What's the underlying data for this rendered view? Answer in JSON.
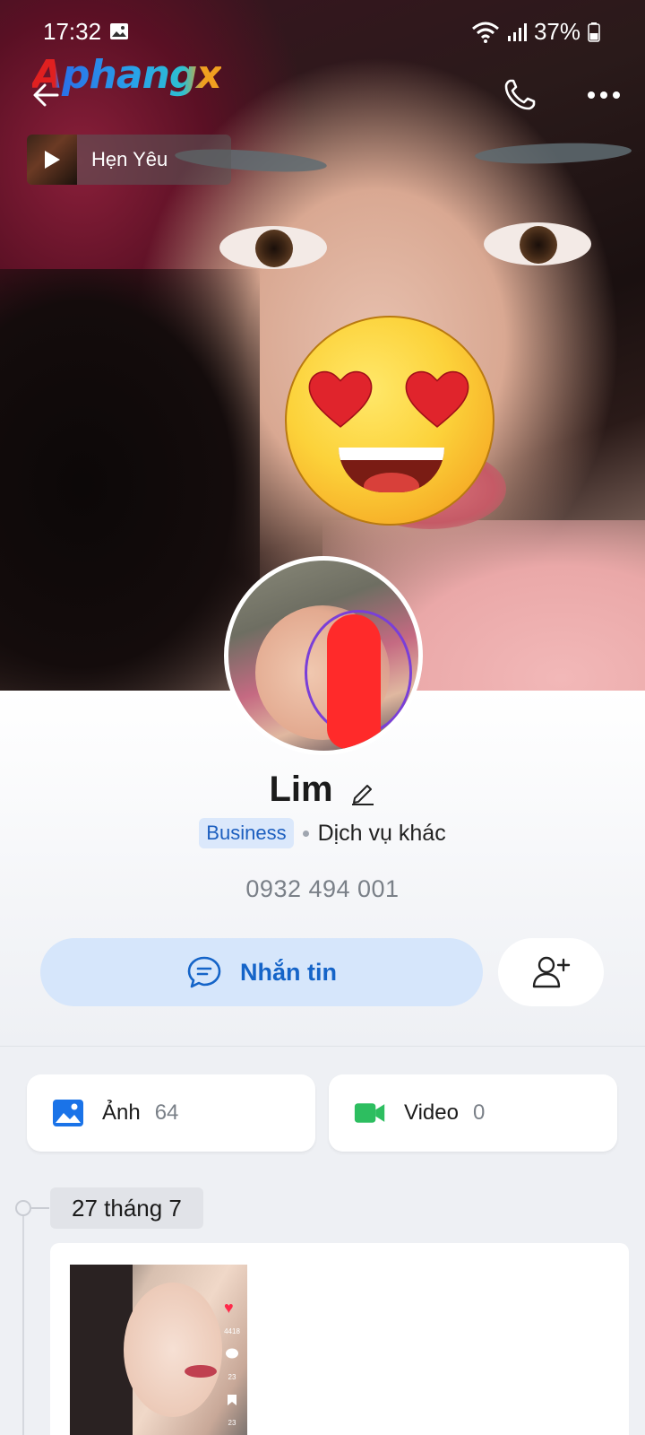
{
  "status_bar": {
    "time": "17:32",
    "battery": "37%",
    "icons": [
      "image-icon",
      "wifi-icon",
      "signal-icon",
      "battery-icon"
    ]
  },
  "header": {
    "watermark": "Aphangx",
    "icons": [
      "back-arrow-icon",
      "phone-icon",
      "more-icon"
    ]
  },
  "music": {
    "title": "Hẹn Yêu",
    "icon": "play-icon"
  },
  "profile": {
    "name": "Lim",
    "badge": "Business",
    "category": "Dịch vụ khác",
    "phone": "0932 494 001"
  },
  "actions": {
    "message_label": "Nhắn tin",
    "message_icon": "chat-bubble-icon",
    "add_friend_icon": "add-user-icon"
  },
  "media": {
    "photos": {
      "label": "Ảnh",
      "count": "64",
      "icon": "image-icon"
    },
    "videos": {
      "label": "Video",
      "count": "0",
      "icon": "video-camera-icon"
    }
  },
  "timeline": {
    "date": "27 tháng 7",
    "post_stats": {
      "likes": "4418",
      "comments": "23",
      "saves": "23"
    }
  },
  "colors": {
    "accent": "#1564c8",
    "accent_light": "#d6e6fb",
    "video_green": "#2dbe60",
    "background": "#eef0f4"
  }
}
